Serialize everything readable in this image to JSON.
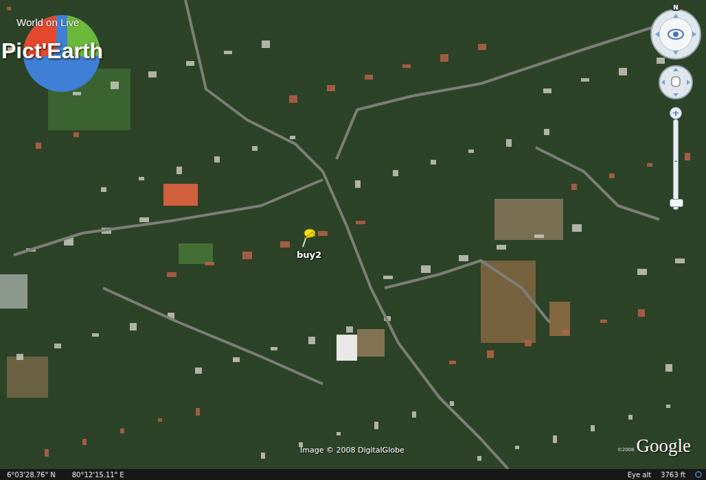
{
  "logo": {
    "tagline": "World on Live",
    "name": "Pict'Earth"
  },
  "placemark": {
    "label": "buy2"
  },
  "compass": {
    "north": "N"
  },
  "zoom_slider": {
    "plus": "+",
    "minus": "-",
    "level": 0.05
  },
  "imagery_credit": "Image © 2008 DigitalGlobe",
  "brand": {
    "copyright": "©2008",
    "name": "Google"
  },
  "status_bar": {
    "latitude": "6°03'28.76\" N",
    "longitude": "80°12'15.11\" E",
    "eye_alt_label": "Eye alt",
    "eye_alt_value": "3763 ft"
  }
}
